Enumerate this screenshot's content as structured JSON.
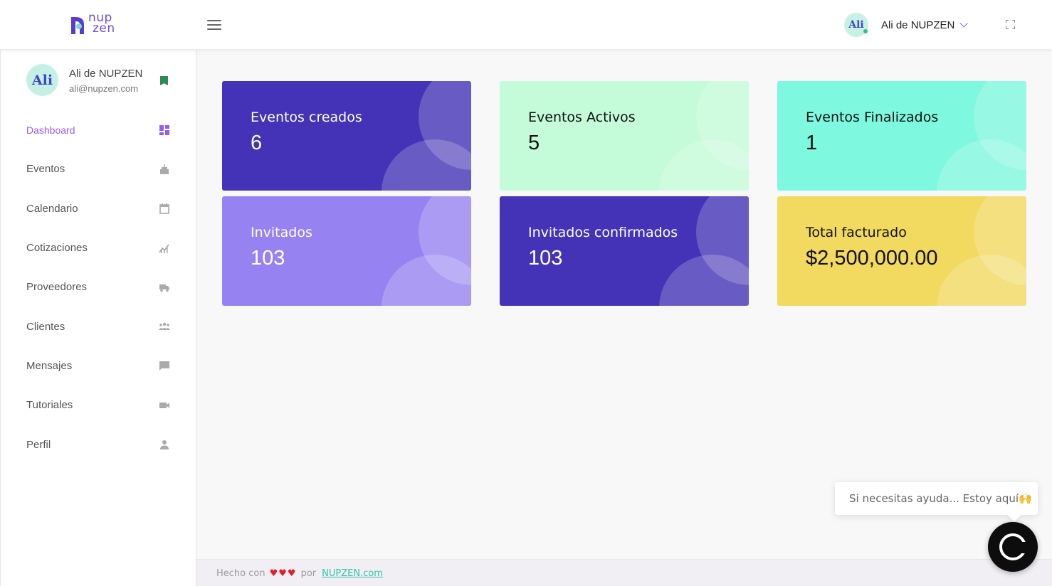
{
  "brand": {
    "logo_line1": "nup",
    "logo_line2": "zen",
    "colors": {
      "primary": "#6d4de0",
      "accent": "#9b59f5"
    }
  },
  "topbar": {
    "menu_icon": "hamburger-icon",
    "user_name": "Ali de NUPZEN",
    "avatar_text": "Ali",
    "fullscreen_icon": "fullscreen-icon"
  },
  "sidebar": {
    "profile": {
      "avatar_text": "Ali",
      "name": "Ali de NUPZEN",
      "email": "ali@nupzen.com",
      "badge_icon": "verified-bookmark-icon"
    },
    "items": [
      {
        "label": "Dashboard",
        "icon": "dashboard-icon",
        "active": true
      },
      {
        "label": "Eventos",
        "icon": "cake-icon"
      },
      {
        "label": "Calendario",
        "icon": "calendar-icon"
      },
      {
        "label": "Cotizaciones",
        "icon": "chart-icon"
      },
      {
        "label": "Proveedores",
        "icon": "truck-icon"
      },
      {
        "label": "Clientes",
        "icon": "group-icon"
      },
      {
        "label": "Mensajes",
        "icon": "message-icon"
      },
      {
        "label": "Tutoriales",
        "icon": "video-icon"
      },
      {
        "label": "Perfil",
        "icon": "person-icon"
      }
    ]
  },
  "cards": [
    {
      "title": "Eventos creados",
      "value": "6",
      "color": "#4433b6"
    },
    {
      "title": "Eventos Activos",
      "value": "5",
      "color": "#c4fbd8"
    },
    {
      "title": "Eventos Finalizados",
      "value": "1",
      "color": "#7ef8de"
    },
    {
      "title": "Invitados",
      "value": "103",
      "color": "#9682f0"
    },
    {
      "title": "Invitados confirmados",
      "value": "103",
      "color": "#4433b6"
    },
    {
      "title": "Total facturado",
      "value": "$2,500,000.00",
      "color": "#f2d95f"
    }
  ],
  "footer": {
    "made_with": "Hecho con",
    "hearts": "♥♥♥",
    "by": "por",
    "link": "NUPZEN.com"
  },
  "chat": {
    "message": "Si necesitas ayuda... Estoy aquí🙌"
  }
}
